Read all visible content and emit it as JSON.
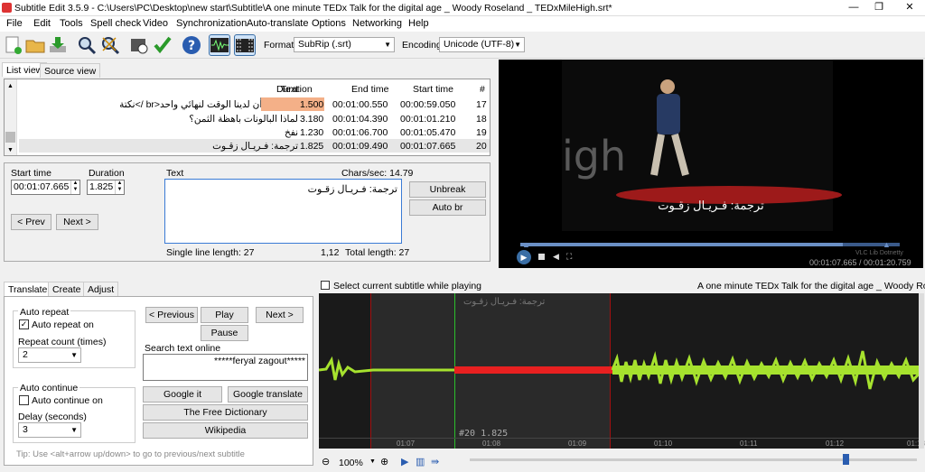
{
  "window": {
    "title": "Subtitle Edit 3.5.9 - C:\\Users\\PC\\Desktop\\new start\\Subtitle\\A one minute TEDx Talk for the digital age _ Woody Roseland _ TEDxMileHigh.srt*",
    "min": "—",
    "max": "❐",
    "close": "✕"
  },
  "menu": [
    "File",
    "Edit",
    "Tools",
    "Spell check",
    "Video",
    "Synchronization",
    "Auto-translate",
    "Options",
    "Networking",
    "Help"
  ],
  "toolbar": {
    "format_label": "Format",
    "format_value": "SubRip (.srt)",
    "encoding_label": "Encoding",
    "encoding_value": "Unicode (UTF-8)"
  },
  "tabs": {
    "list": "List view",
    "source": "Source view"
  },
  "grid": {
    "headers": {
      "text": "Text",
      "duration": "Duration",
      "end": "End time",
      "start": "Start time",
      "num": "#"
    },
    "rows": [
      {
        "text": "هذا يعني أن لدينا الوقت لنهائي واحد<br />نكتة",
        "duration": "1.500",
        "end": "00:01:00.550",
        "start": "00:00:59.050",
        "num": "17"
      },
      {
        "text": "لماذا البالونات باهظة الثمن؟",
        "duration": "3.180",
        "end": "00:01:04.390",
        "start": "00:01:01.210",
        "num": "18"
      },
      {
        "text": "نفخ",
        "duration": "1.230",
        "end": "00:01:06.700",
        "start": "00:01:05.470",
        "num": "19"
      },
      {
        "text": "ترجمة: فـريـال زقـوت",
        "duration": "1.825",
        "end": "00:01:09.490",
        "start": "00:01:07.665",
        "num": "20"
      }
    ]
  },
  "edit": {
    "start_label": "Start time",
    "start_value": "00:01:07.665",
    "duration_label": "Duration",
    "duration_value": "1.825",
    "text_label": "Text",
    "chars": "Chars/sec: 14.79",
    "text_value": "ترجمة: فـريـال زقـوت",
    "prev": "< Prev",
    "next": "Next >",
    "unbreak": "Unbreak",
    "auto_br": "Auto br",
    "single_line": "Single line length: 27",
    "pos": "1,12",
    "total": "Total length: 27"
  },
  "video": {
    "caption": "ترجمة: فـريـال زقـوت",
    "bg_text": "igh",
    "time": "00:01:07.665 / 00:01:20.759",
    "brand": "VLC Lib Dotnetty"
  },
  "bottom_tabs": [
    "Translate",
    "Create",
    "Adjust"
  ],
  "translate": {
    "auto_repeat": "Auto repeat",
    "auto_repeat_on": "Auto repeat on",
    "repeat_count": "Repeat count (times)",
    "repeat_value": "2",
    "auto_continue": "Auto continue",
    "auto_continue_on": "Auto continue on",
    "delay": "Delay (seconds)",
    "delay_value": "3",
    "previous": "< Previous",
    "play": "Play",
    "next": "Next >",
    "pause": "Pause",
    "search_label": "Search text online",
    "search_value": "*****feryal zagout*****",
    "google_it": "Google it",
    "google_translate": "Google translate",
    "dictionary": "The Free Dictionary",
    "wikipedia": "Wikipedia",
    "tip": "Tip: Use <alt+arrow up/down> to go to previous/next subtitle"
  },
  "waveform": {
    "select_label": "Select current subtitle while playing",
    "title": "A one minute TEDx Talk for the digital age _ Woody Roseland",
    "sub_text": "ترجمة: فـريـال زقـوت",
    "marker": "#20  1.825",
    "ticks": [
      "01:07",
      "01:08",
      "01:09",
      "01:10",
      "01:11",
      "01:12",
      "01:13"
    ],
    "zoom": "100%",
    "slider_position": 0.84
  }
}
